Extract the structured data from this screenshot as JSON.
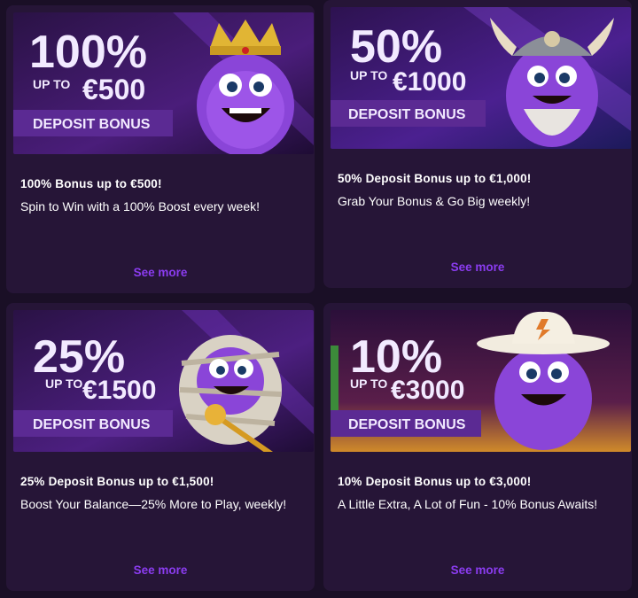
{
  "promos": [
    {
      "percent": "100%",
      "up_to_label": "UP TO",
      "amount": "€500",
      "badge": "DEPOSIT BONUS",
      "title": "100% Bonus up to €500!",
      "description": "Spin to Win with a 100% Boost every week!",
      "link": "See more",
      "mascot": "crown"
    },
    {
      "percent": "50%",
      "up_to_label": "UP TO",
      "amount": "€1000",
      "badge": "DEPOSIT BONUS",
      "title": "50% Deposit Bonus up to €1,000!",
      "description": "Grab Your Bonus & Go Big weekly!",
      "link": "See more",
      "mascot": "viking-helmet"
    },
    {
      "percent": "25%",
      "up_to_label": "UP TO",
      "amount": "€1500",
      "badge": "DEPOSIT BONUS",
      "title": "25% Deposit Bonus up to €1,500!",
      "description": "Boost Your Balance—25% More to Play, weekly!",
      "link": "See more",
      "mascot": "mummy-wraps"
    },
    {
      "percent": "10%",
      "up_to_label": "UP TO",
      "amount": "€3000",
      "badge": "DEPOSIT BONUS",
      "title": "10% Deposit Bonus up to €3,000!",
      "description": "A Little Extra, A Lot of Fun - 10% Bonus Awaits!",
      "link": "See more",
      "mascot": "cowboy-hat"
    }
  ],
  "colors": {
    "page_bg": "#1a0f26",
    "card_bg": "#261537",
    "link": "#8b3cf0",
    "badge_bg": "#5b2a93",
    "banner_bg": "#2a1245"
  }
}
